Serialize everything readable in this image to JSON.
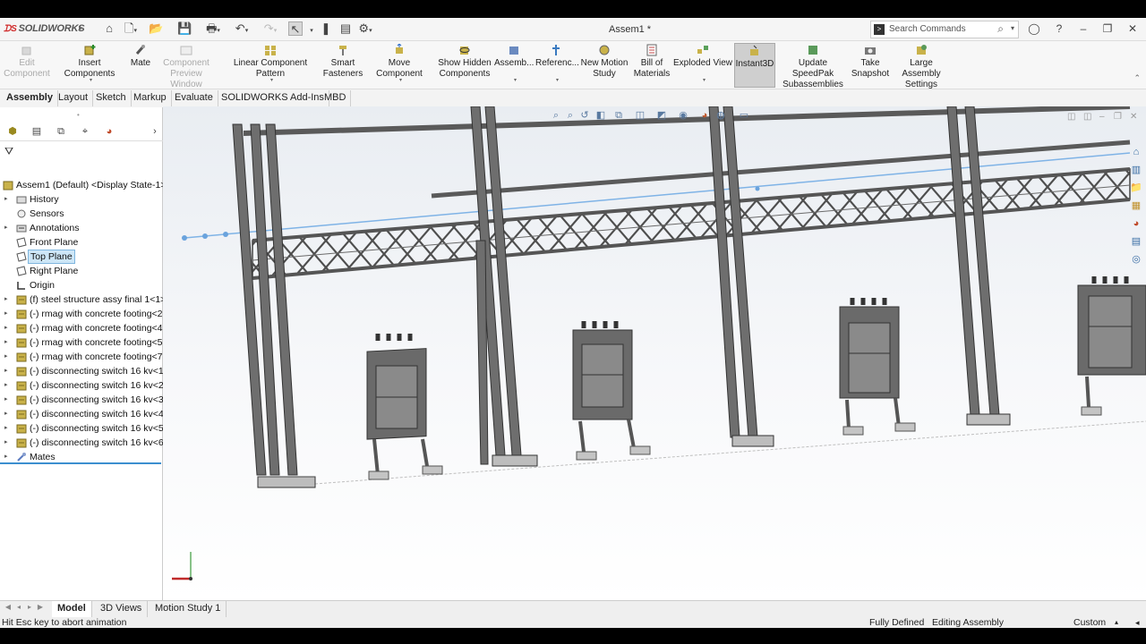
{
  "app": {
    "brand": "SOLIDWORKS",
    "document_title": "Assem1 *"
  },
  "search": {
    "placeholder": "Search Commands"
  },
  "commands": [
    {
      "label": "Edit\nComponent",
      "icon": "edit-component-icon",
      "disabled": true
    },
    {
      "label": "Insert Components",
      "icon": "insert-components-icon"
    },
    {
      "label": "Mate",
      "icon": "mate-icon"
    },
    {
      "label": "Component\nPreview Window",
      "icon": "preview-window-icon",
      "disabled": true
    },
    {
      "label": "Linear Component Pattern",
      "icon": "linear-pattern-icon"
    },
    {
      "label": "Smart\nFasteners",
      "icon": "smart-fasteners-icon"
    },
    {
      "label": "Move Component",
      "icon": "move-component-icon"
    },
    {
      "label": "Show Hidden\nComponents",
      "icon": "show-hidden-icon"
    },
    {
      "label": "Assemb...",
      "icon": "assembly-features-icon"
    },
    {
      "label": "Referenc...",
      "icon": "reference-geometry-icon"
    },
    {
      "label": "New Motion\nStudy",
      "icon": "motion-study-icon"
    },
    {
      "label": "Bill of\nMaterials",
      "icon": "bom-icon"
    },
    {
      "label": "Exploded View",
      "icon": "exploded-view-icon"
    },
    {
      "label": "Instant3D",
      "icon": "instant3d-icon",
      "active": true
    },
    {
      "label": "Update SpeedPak\nSubassemblies",
      "icon": "speedpak-icon"
    },
    {
      "label": "Take\nSnapshot",
      "icon": "snapshot-icon"
    },
    {
      "label": "Large Assembly\nSettings",
      "icon": "large-assembly-icon"
    }
  ],
  "tabs": [
    "Assembly",
    "Layout",
    "Sketch",
    "Markup",
    "Evaluate",
    "SOLIDWORKS Add-Ins",
    "MBD"
  ],
  "tree": {
    "root": "Assem1 (Default) <Display State-1>",
    "items": [
      {
        "label": "History",
        "icon": "history-folder-icon",
        "expandable": true
      },
      {
        "label": "Sensors",
        "icon": "sensors-icon",
        "expandable": false
      },
      {
        "label": "Annotations",
        "icon": "annotations-icon",
        "expandable": true
      },
      {
        "label": "Front Plane",
        "icon": "plane-icon",
        "expandable": false
      },
      {
        "label": "Top Plane",
        "icon": "plane-icon",
        "expandable": false,
        "selected": true
      },
      {
        "label": "Right Plane",
        "icon": "plane-icon",
        "expandable": false
      },
      {
        "label": "Origin",
        "icon": "origin-icon",
        "expandable": false
      },
      {
        "label": "(f) steel structure assy final 1<1>",
        "icon": "assembly-component-icon",
        "expandable": true
      },
      {
        "label": "(-) rmag with concrete footing<2",
        "icon": "assembly-component-icon",
        "expandable": true
      },
      {
        "label": "(-) rmag with concrete footing<4",
        "icon": "assembly-component-icon",
        "expandable": true
      },
      {
        "label": "(-) rmag with concrete footing<5",
        "icon": "assembly-component-icon",
        "expandable": true
      },
      {
        "label": "(-) rmag with concrete footing<7",
        "icon": "assembly-component-icon",
        "expandable": true
      },
      {
        "label": "(-) disconnecting switch 16 kv<1>",
        "icon": "assembly-component-icon",
        "expandable": true
      },
      {
        "label": "(-) disconnecting switch 16 kv<2>",
        "icon": "assembly-component-icon",
        "expandable": true
      },
      {
        "label": "(-) disconnecting switch 16 kv<3>",
        "icon": "assembly-component-icon",
        "expandable": true
      },
      {
        "label": "(-) disconnecting switch 16 kv<4>",
        "icon": "assembly-component-icon",
        "expandable": true
      },
      {
        "label": "(-) disconnecting switch 16 kv<5>",
        "icon": "assembly-component-icon",
        "expandable": true
      },
      {
        "label": "(-) disconnecting switch 16 kv<6>",
        "icon": "assembly-component-icon",
        "expandable": true
      },
      {
        "label": "Mates",
        "icon": "mates-icon",
        "expandable": true
      }
    ]
  },
  "bottom_tabs": [
    "Model",
    "3D Views",
    "Motion Study 1"
  ],
  "status": {
    "message": "Hit Esc key to abort animation",
    "definition": "Fully Defined",
    "mode": "Editing Assembly",
    "units": "Custom"
  },
  "colors": {
    "accent": "#3c8fcf",
    "brand": "#d02a2a",
    "selection_bg": "#cde6f7",
    "steel": "#6e6e6e",
    "wire": "#7fb3e6"
  }
}
